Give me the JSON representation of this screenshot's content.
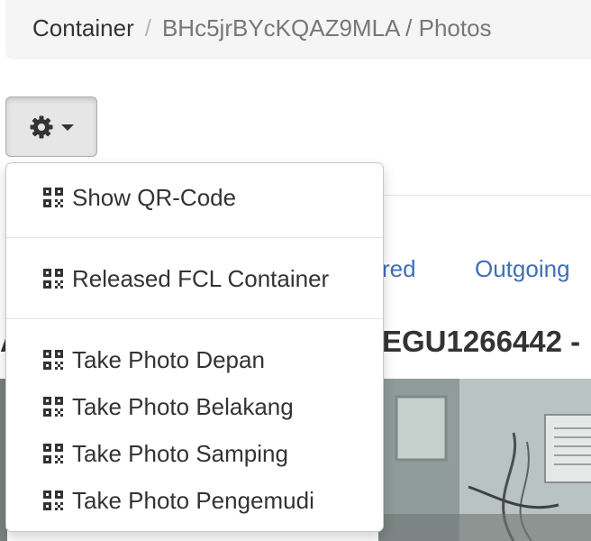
{
  "breadcrumb": {
    "root": "Container",
    "separator": "/",
    "current": "BHc5jrBYcKQAZ9MLA / Photos"
  },
  "toolbar": {
    "settings_icon": "gear-icon",
    "caret_icon": "caret-down-icon"
  },
  "dropdown": {
    "items": [
      {
        "label": "Show QR-Code",
        "icon": "qrcode-icon"
      },
      {
        "label": "Released FCL Container",
        "icon": "qrcode-icon"
      },
      {
        "label": "Take Photo Depan",
        "icon": "qrcode-icon"
      },
      {
        "label": "Take Photo Belakang",
        "icon": "qrcode-icon"
      },
      {
        "label": "Take Photo Samping",
        "icon": "qrcode-icon"
      },
      {
        "label": "Take Photo Pengemudi",
        "icon": "qrcode-icon"
      }
    ]
  },
  "tabs": [
    {
      "label": "red"
    },
    {
      "label": "Outgoing"
    }
  ],
  "container_heading": {
    "prefix": "A",
    "text": "EGU1266442 -"
  },
  "colors": {
    "link": "#3f6fb5",
    "breadcrumb_bg": "#f5f5f5",
    "button_active_bg": "#e6e6e6"
  }
}
